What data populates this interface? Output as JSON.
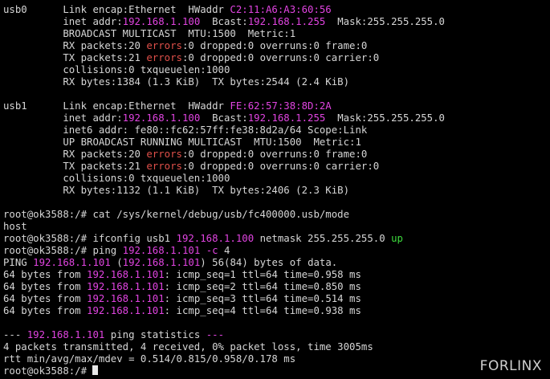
{
  "colors": {
    "background": "#000000",
    "text": "#d6d6d6",
    "ip_address": "#e144e1",
    "errors": "#e0504a",
    "up": "#3ddc3d"
  },
  "terminal": {
    "lines": [
      [
        {
          "t": "usb0      Link encap:Ethernet  HWaddr "
        },
        {
          "t": "C2:11:A6:A3:60:56",
          "c": "magenta"
        }
      ],
      [
        {
          "t": "          inet addr:"
        },
        {
          "t": "192.168.1.100",
          "c": "magenta"
        },
        {
          "t": "  Bcast:"
        },
        {
          "t": "192.168.1.255",
          "c": "magenta"
        },
        {
          "t": "  Mask:255.255.255.0"
        }
      ],
      [
        {
          "t": "          BROADCAST MULTICAST  MTU:1500  Metric:1"
        }
      ],
      [
        {
          "t": "          RX packets:20 "
        },
        {
          "t": "errors",
          "c": "red"
        },
        {
          "t": ":0 dropped:0 overruns:0 frame:0"
        }
      ],
      [
        {
          "t": "          TX packets:21 "
        },
        {
          "t": "errors",
          "c": "red"
        },
        {
          "t": ":0 dropped:0 overruns:0 carrier:0"
        }
      ],
      [
        {
          "t": "          collisions:0 txqueuelen:1000"
        }
      ],
      [
        {
          "t": "          RX bytes:1384 (1.3 KiB)  TX bytes:2544 (2.4 KiB)"
        }
      ],
      [
        {
          "t": ""
        }
      ],
      [
        {
          "t": "usb1      Link encap:Ethernet  HWaddr "
        },
        {
          "t": "FE:62:57:38:8D:2A",
          "c": "magenta"
        }
      ],
      [
        {
          "t": "          inet addr:"
        },
        {
          "t": "192.168.1.100",
          "c": "magenta"
        },
        {
          "t": "  Bcast:"
        },
        {
          "t": "192.168.1.255",
          "c": "magenta"
        },
        {
          "t": "  Mask:255.255.255.0"
        }
      ],
      [
        {
          "t": "          inet6 addr: fe80::fc62:57ff:fe38:8d2a/64 Scope:Link"
        }
      ],
      [
        {
          "t": "          UP BROADCAST RUNNING MULTICAST  MTU:1500  Metric:1"
        }
      ],
      [
        {
          "t": "          RX packets:20 "
        },
        {
          "t": "errors",
          "c": "red"
        },
        {
          "t": ":0 dropped:0 overruns:0 frame:0"
        }
      ],
      [
        {
          "t": "          TX packets:21 "
        },
        {
          "t": "errors",
          "c": "red"
        },
        {
          "t": ":0 dropped:0 overruns:0 carrier:0"
        }
      ],
      [
        {
          "t": "          collisions:0 txqueuelen:1000"
        }
      ],
      [
        {
          "t": "          RX bytes:1132 (1.1 KiB)  TX bytes:2406 (2.3 KiB)"
        }
      ],
      [
        {
          "t": ""
        }
      ],
      [
        {
          "t": "root@ok3588:/# cat /sys/kernel/debug/usb/fc400000.usb/mode"
        }
      ],
      [
        {
          "t": "host"
        }
      ],
      [
        {
          "t": "root@ok3588:/# ifconfig usb1 "
        },
        {
          "t": "192.168.1.100",
          "c": "magenta"
        },
        {
          "t": " netmask 255.255.255.0 "
        },
        {
          "t": "up",
          "c": "green"
        }
      ],
      [
        {
          "t": "root@ok3588:/# ping "
        },
        {
          "t": "192.168.1.101",
          "c": "magenta"
        },
        {
          "t": " "
        },
        {
          "t": "-c",
          "c": "magenta"
        },
        {
          "t": " 4"
        }
      ],
      [
        {
          "t": "PING "
        },
        {
          "t": "192.168.1.101",
          "c": "magenta"
        },
        {
          "t": " ("
        },
        {
          "t": "192.168.1.101",
          "c": "magenta"
        },
        {
          "t": ") 56(84) bytes of data."
        }
      ],
      [
        {
          "t": "64 bytes from "
        },
        {
          "t": "192.168.1.101",
          "c": "magenta"
        },
        {
          "t": ": icmp_seq=1 ttl=64 time=0.958 ms"
        }
      ],
      [
        {
          "t": "64 bytes from "
        },
        {
          "t": "192.168.1.101",
          "c": "magenta"
        },
        {
          "t": ": icmp_seq=2 ttl=64 time=0.850 ms"
        }
      ],
      [
        {
          "t": "64 bytes from "
        },
        {
          "t": "192.168.1.101",
          "c": "magenta"
        },
        {
          "t": ": icmp_seq=3 ttl=64 time=0.514 ms"
        }
      ],
      [
        {
          "t": "64 bytes from "
        },
        {
          "t": "192.168.1.101",
          "c": "magenta"
        },
        {
          "t": ": icmp_seq=4 ttl=64 time=0.938 ms"
        }
      ],
      [
        {
          "t": ""
        }
      ],
      [
        {
          "t": "--- "
        },
        {
          "t": "192.168.1.101",
          "c": "magenta"
        },
        {
          "t": " ping statistics "
        },
        {
          "t": "---",
          "c": "magenta"
        }
      ],
      [
        {
          "t": "4 packets transmitted, 4 received, 0% packet loss, time 3005ms"
        }
      ],
      [
        {
          "t": "rtt min/avg/max/mdev = 0.514/0.815/0.958/0.178 ms"
        }
      ],
      [
        {
          "t": "root@ok3588:/# "
        }
      ]
    ]
  },
  "watermark": "FORLINX"
}
